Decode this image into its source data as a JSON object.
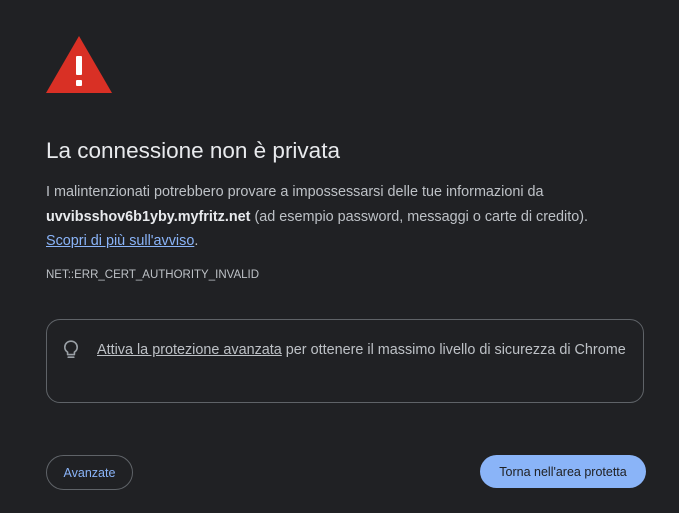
{
  "page": {
    "title": "La connessione non è privata",
    "warning_text_before_host": "I malintenzionati potrebbero provare a impossessarsi delle tue informazioni da ",
    "host": "uvvibsshov6b1yby.myfritz.net",
    "warning_text_after_host": " (ad esempio password, messaggi o carte di credito).",
    "learn_more_link": "Scopri di più sull'avviso",
    "learn_more_suffix": ".",
    "error_code": "NET::ERR_CERT_AUTHORITY_INVALID"
  },
  "enhanced_protection": {
    "link_text": "Attiva la protezione avanzata",
    "text": " per ottenere il massimo livello di sicurezza di Chrome"
  },
  "buttons": {
    "advanced_label": "Avanzate",
    "back_to_safety_label": "Torna nell'area protetta"
  },
  "icons": {
    "warning": "warning-triangle-icon",
    "bulb": "lightbulb-icon"
  },
  "colors": {
    "background": "#202124",
    "warning_red": "#d93025",
    "link_blue": "#8ab4f8",
    "title_text": "#e8eaed",
    "body_text": "#bdc1c6",
    "border": "#5f6368"
  }
}
